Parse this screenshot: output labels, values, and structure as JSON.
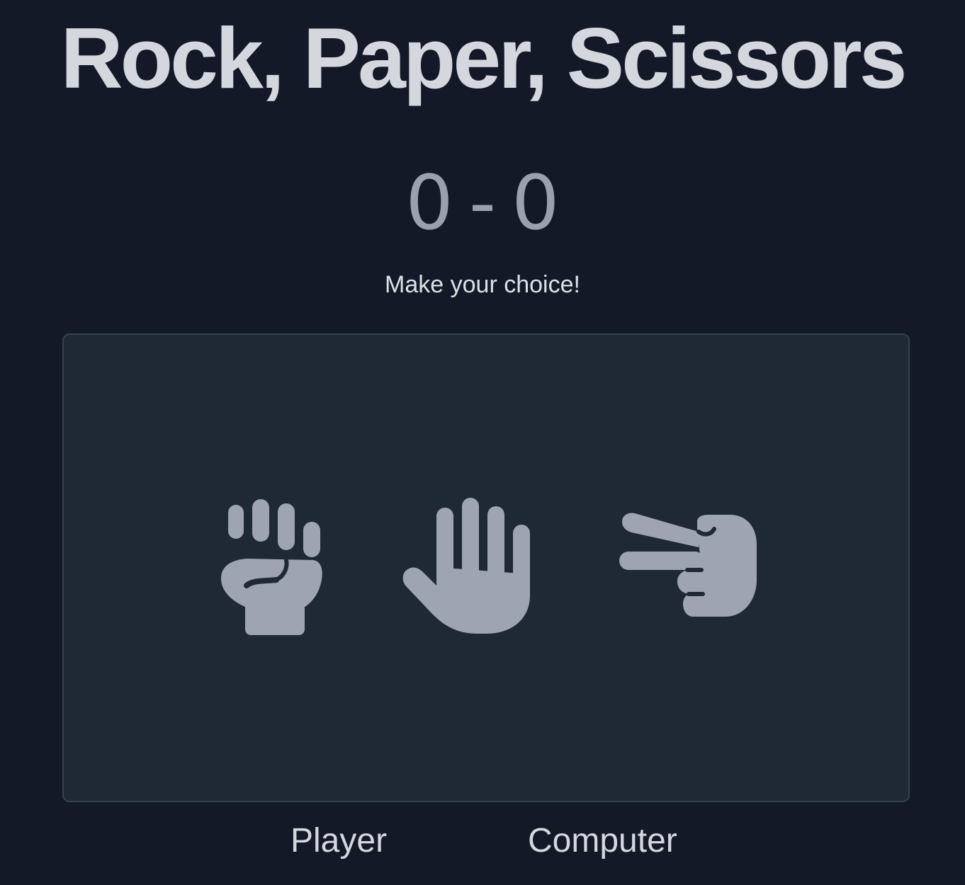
{
  "title": "Rock, Paper, Scissors",
  "score": {
    "player": "0",
    "separator": "-",
    "computer": "0"
  },
  "status_message": "Make your choice!",
  "choices": [
    {
      "name": "rock",
      "icon": "fist-rock-icon"
    },
    {
      "name": "paper",
      "icon": "hand-paper-icon"
    },
    {
      "name": "scissors",
      "icon": "hand-scissors-icon"
    }
  ],
  "labels": {
    "player": "Player",
    "computer": "Computer"
  },
  "colors": {
    "background": "#131926",
    "board": "#1f2835",
    "icon": "#9ea4b0",
    "title": "#d4d7de"
  }
}
